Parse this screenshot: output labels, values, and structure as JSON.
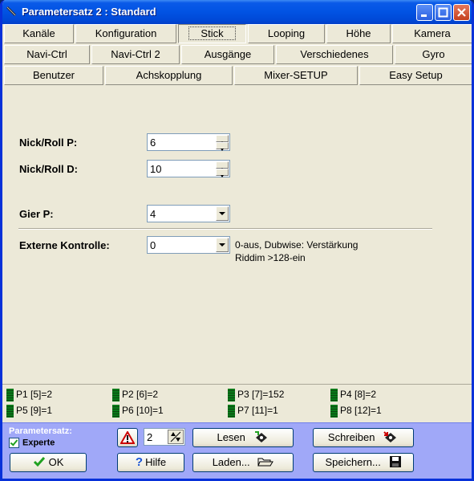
{
  "window": {
    "title": "Parametersatz 2 : Standard"
  },
  "tabs": {
    "row1": [
      "Kanäle",
      "Konfiguration",
      "Stick",
      "Looping",
      "Höhe",
      "Kamera"
    ],
    "row2": [
      "Navi-Ctrl",
      "Navi-Ctrl 2",
      "Ausgänge",
      "Verschiedenes",
      "Gyro"
    ],
    "row3": [
      "Benutzer",
      "Achskopplung",
      "Mixer-SETUP",
      "Easy Setup"
    ],
    "active": "Stick"
  },
  "fields": {
    "nick_roll_p": {
      "label": "Nick/Roll P:",
      "value": "6"
    },
    "nick_roll_d": {
      "label": "Nick/Roll D:",
      "value": "10"
    },
    "gier_p": {
      "label": "Gier P:",
      "value": "4"
    },
    "externe_kontrolle": {
      "label": "Externe Kontrolle:",
      "value": "0",
      "hint_line1": "0-aus, Dubwise: Verstärkung",
      "hint_line2": "Riddim >128-ein"
    }
  },
  "poti": [
    "P1 [5]=2",
    "P2 [6]=2",
    "P3 [7]=152",
    "P4 [8]=2",
    "P5 [9]=1",
    "P6 [10]=1",
    "P7 [11]=1",
    "P8 [12]=1"
  ],
  "bottom": {
    "parametersatz_label": "Parametersatz:",
    "experte_label": "Experte",
    "experte_checked": true,
    "set_number": "2",
    "ok_label": "OK",
    "hilfe_label": "Hilfe",
    "lesen_label": "Lesen",
    "laden_label": "Laden...",
    "schreiben_label": "Schreiben",
    "speichern_label": "Speichern..."
  }
}
